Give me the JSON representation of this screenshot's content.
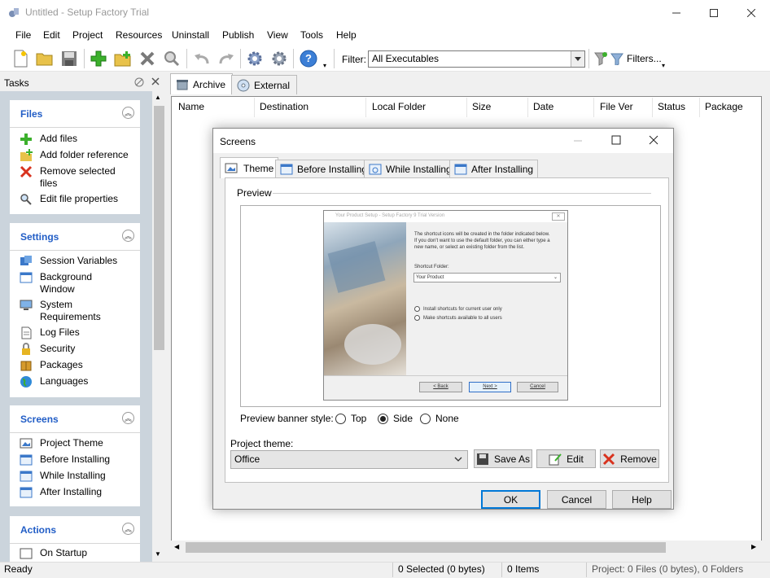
{
  "window": {
    "title": "Untitled - Setup Factory Trial"
  },
  "menu": [
    "File",
    "Edit",
    "Project",
    "Resources",
    "Uninstall",
    "Publish",
    "View",
    "Tools",
    "Help"
  ],
  "toolbar": {
    "filter_label": "Filter:",
    "filter_value": "All Executables",
    "filters_button": "Filters..."
  },
  "tasks": {
    "title": "Tasks",
    "files": {
      "title": "Files",
      "items": [
        "Add files",
        "Add folder reference",
        "Remove selected",
        "files",
        "Edit file properties"
      ]
    },
    "settings": {
      "title": "Settings",
      "items": [
        "Session Variables",
        "Background",
        "Window",
        "System",
        "Requirements",
        "Log Files",
        "Security",
        "Packages",
        "Languages"
      ]
    },
    "screens": {
      "title": "Screens",
      "items": [
        "Project Theme",
        "Before Installing",
        "While Installing",
        "After Installing"
      ]
    },
    "actions": {
      "title": "Actions",
      "items": [
        "On Startup"
      ]
    }
  },
  "tabs": [
    "Archive",
    "External"
  ],
  "columns": [
    "Name",
    "Destination",
    "Local Folder",
    "Size",
    "Date",
    "File Ver",
    "Status",
    "Package"
  ],
  "status": {
    "ready": "Ready",
    "selected": "0 Selected (0 bytes)",
    "items": "0 Items",
    "project": "Project: 0 Files (0 bytes), 0 Folders"
  },
  "dialog": {
    "title": "Screens",
    "tabs": [
      "Theme",
      "Before Installing",
      "While Installing",
      "After Installing"
    ],
    "preview_label": "Preview",
    "banner_label": "Preview banner style:",
    "banner_options": [
      "Top",
      "Side",
      "None"
    ],
    "banner_selected": "Side",
    "theme_label": "Project theme:",
    "theme_value": "Office",
    "save_as": "Save As",
    "edit": "Edit",
    "remove": "Remove",
    "ok": "OK",
    "cancel": "Cancel",
    "help": "Help",
    "mini": {
      "title": "Your Product Setup - Setup Factory 9 Trial Version",
      "text1": "The shortcut icons will be created in the folder indicated below.",
      "text2": "If you don't want to use the default folder, you can either type a",
      "text3": "new name, or select an existing folder from the list.",
      "folder_label": "Shortcut Folder:",
      "folder_value": "Your Product",
      "opt1": "Install shortcuts for current user only",
      "opt2": "Make shortcuts available to all users",
      "back": "< Back",
      "next": "Next >",
      "cancel": "Cancel"
    }
  }
}
